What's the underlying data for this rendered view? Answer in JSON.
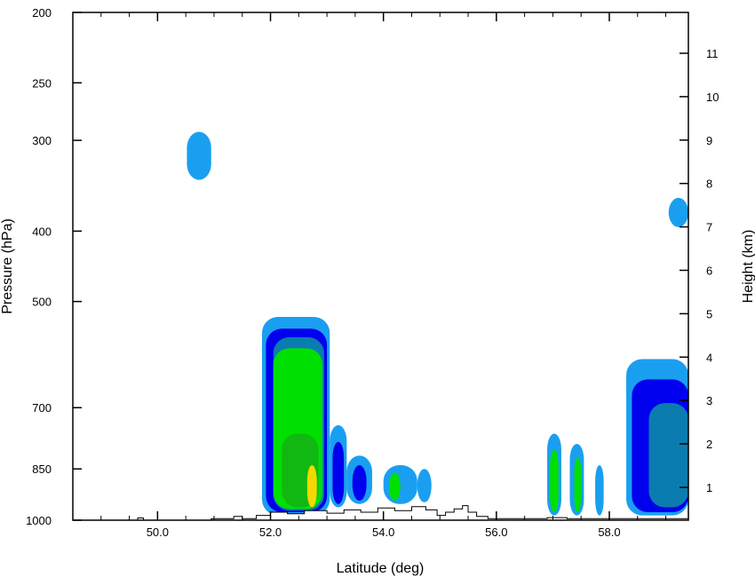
{
  "chart_data": {
    "type": "contour",
    "xlabel": "Latitude (deg)",
    "ylabel_left": "Pressure (hPa)",
    "ylabel_right": "Height (km)",
    "xlim": [
      48.5,
      59.4
    ],
    "x_ticks": [
      {
        "value": 50.0,
        "label": "50.0"
      },
      {
        "value": 52.0,
        "label": "52.0"
      },
      {
        "value": 54.0,
        "label": "54.0"
      },
      {
        "value": 56.0,
        "label": "56.0"
      },
      {
        "value": 58.0,
        "label": "58.0"
      }
    ],
    "x_minor_ticks": [
      48.5,
      49.0,
      49.5,
      50.5,
      51.0,
      51.5,
      52.5,
      53.0,
      53.5,
      54.5,
      55.0,
      55.5,
      56.5,
      57.0,
      57.5,
      58.5,
      59.0
    ],
    "pressure_log_scale": true,
    "pressure_lim": [
      1000,
      200
    ],
    "pressure_ticks": [
      {
        "value": 1000,
        "label": "1000"
      },
      {
        "value": 850,
        "label": "850"
      },
      {
        "value": 700,
        "label": "700"
      },
      {
        "value": 500,
        "label": "500"
      },
      {
        "value": 400,
        "label": "400"
      },
      {
        "value": 300,
        "label": "300"
      },
      {
        "value": 250,
        "label": "250"
      },
      {
        "value": 200,
        "label": "200"
      }
    ],
    "height_ticks": [
      {
        "value": 1,
        "label": "1"
      },
      {
        "value": 2,
        "label": "2"
      },
      {
        "value": 3,
        "label": "3"
      },
      {
        "value": 4,
        "label": "4"
      },
      {
        "value": 5,
        "label": "5"
      },
      {
        "value": 6,
        "label": "6"
      },
      {
        "value": 7,
        "label": "7"
      },
      {
        "value": 8,
        "label": "8"
      },
      {
        "value": 9,
        "label": "9"
      },
      {
        "value": 10,
        "label": "10"
      },
      {
        "value": 11,
        "label": "11"
      }
    ],
    "contour_colors": [
      "#1a9ff0",
      "#0000ee",
      "#0a7cb0",
      "#00e000",
      "#12b812",
      "#f5d800"
    ],
    "cells": [
      {
        "lat": [
          50.52,
          50.95
        ],
        "p_bottom": 340,
        "p_top": 292,
        "level": 1
      },
      {
        "lat": [
          59.05,
          59.4
        ],
        "p_bottom": 395,
        "p_top": 360,
        "level": 1
      },
      {
        "lat": [
          51.85,
          53.05
        ],
        "p_bottom": 985,
        "p_top": 525,
        "level": 1
      },
      {
        "lat": [
          51.92,
          53.0
        ],
        "p_bottom": 975,
        "p_top": 545,
        "level": 2
      },
      {
        "lat": [
          52.05,
          52.95
        ],
        "p_bottom": 970,
        "p_top": 560,
        "level": 3
      },
      {
        "lat": [
          52.05,
          52.92
        ],
        "p_bottom": 965,
        "p_top": 580,
        "level": 4
      },
      {
        "lat": [
          52.2,
          52.85
        ],
        "p_bottom": 960,
        "p_top": 760,
        "level": 5
      },
      {
        "lat": [
          52.65,
          52.82
        ],
        "p_bottom": 960,
        "p_top": 840,
        "level": 6
      },
      {
        "lat": [
          53.05,
          53.35
        ],
        "p_bottom": 960,
        "p_top": 740,
        "level": 1
      },
      {
        "lat": [
          53.1,
          53.3
        ],
        "p_bottom": 950,
        "p_top": 780,
        "level": 2
      },
      {
        "lat": [
          53.35,
          53.8
        ],
        "p_bottom": 950,
        "p_top": 815,
        "level": 1
      },
      {
        "lat": [
          53.45,
          53.7
        ],
        "p_bottom": 940,
        "p_top": 840,
        "level": 2
      },
      {
        "lat": [
          54.0,
          54.6
        ],
        "p_bottom": 950,
        "p_top": 840,
        "level": 1
      },
      {
        "lat": [
          54.1,
          54.3
        ],
        "p_bottom": 940,
        "p_top": 860,
        "level": 4
      },
      {
        "lat": [
          54.6,
          54.85
        ],
        "p_bottom": 945,
        "p_top": 850,
        "level": 1
      },
      {
        "lat": [
          56.9,
          57.15
        ],
        "p_bottom": 985,
        "p_top": 760,
        "level": 1
      },
      {
        "lat": [
          56.95,
          57.1
        ],
        "p_bottom": 975,
        "p_top": 800,
        "level": 4
      },
      {
        "lat": [
          57.3,
          57.55
        ],
        "p_bottom": 985,
        "p_top": 785,
        "level": 1
      },
      {
        "lat": [
          57.38,
          57.5
        ],
        "p_bottom": 975,
        "p_top": 820,
        "level": 4
      },
      {
        "lat": [
          57.75,
          57.9
        ],
        "p_bottom": 985,
        "p_top": 840,
        "level": 1
      },
      {
        "lat": [
          58.3,
          59.4
        ],
        "p_bottom": 985,
        "p_top": 600,
        "level": 1
      },
      {
        "lat": [
          58.4,
          59.4
        ],
        "p_bottom": 975,
        "p_top": 640,
        "level": 2
      },
      {
        "lat": [
          58.7,
          59.4
        ],
        "p_bottom": 960,
        "p_top": 690,
        "level": 3
      }
    ],
    "terrain": [
      {
        "lat": 48.5,
        "p": 1000
      },
      {
        "lat": 49.65,
        "p": 1000
      },
      {
        "lat": 49.65,
        "p": 993
      },
      {
        "lat": 49.75,
        "p": 993
      },
      {
        "lat": 49.75,
        "p": 1000
      },
      {
        "lat": 50.95,
        "p": 1000
      },
      {
        "lat": 50.95,
        "p": 995
      },
      {
        "lat": 51.35,
        "p": 995
      },
      {
        "lat": 51.35,
        "p": 988
      },
      {
        "lat": 51.5,
        "p": 988
      },
      {
        "lat": 51.5,
        "p": 995
      },
      {
        "lat": 51.75,
        "p": 995
      },
      {
        "lat": 51.75,
        "p": 985
      },
      {
        "lat": 52.0,
        "p": 985
      },
      {
        "lat": 52.0,
        "p": 975
      },
      {
        "lat": 52.3,
        "p": 975
      },
      {
        "lat": 52.3,
        "p": 980
      },
      {
        "lat": 52.6,
        "p": 980
      },
      {
        "lat": 52.6,
        "p": 970
      },
      {
        "lat": 53.0,
        "p": 970
      },
      {
        "lat": 53.0,
        "p": 978
      },
      {
        "lat": 53.3,
        "p": 978
      },
      {
        "lat": 53.3,
        "p": 968
      },
      {
        "lat": 53.6,
        "p": 968
      },
      {
        "lat": 53.6,
        "p": 975
      },
      {
        "lat": 53.9,
        "p": 975
      },
      {
        "lat": 53.9,
        "p": 962
      },
      {
        "lat": 54.2,
        "p": 962
      },
      {
        "lat": 54.2,
        "p": 970
      },
      {
        "lat": 54.5,
        "p": 970
      },
      {
        "lat": 54.5,
        "p": 958
      },
      {
        "lat": 54.75,
        "p": 958
      },
      {
        "lat": 54.75,
        "p": 968
      },
      {
        "lat": 54.95,
        "p": 968
      },
      {
        "lat": 54.95,
        "p": 985
      },
      {
        "lat": 55.1,
        "p": 985
      },
      {
        "lat": 55.1,
        "p": 975
      },
      {
        "lat": 55.25,
        "p": 975
      },
      {
        "lat": 55.25,
        "p": 965
      },
      {
        "lat": 55.4,
        "p": 965
      },
      {
        "lat": 55.4,
        "p": 955
      },
      {
        "lat": 55.5,
        "p": 955
      },
      {
        "lat": 55.5,
        "p": 975
      },
      {
        "lat": 55.65,
        "p": 975
      },
      {
        "lat": 55.65,
        "p": 988
      },
      {
        "lat": 55.85,
        "p": 988
      },
      {
        "lat": 55.85,
        "p": 995
      },
      {
        "lat": 56.9,
        "p": 995
      },
      {
        "lat": 56.9,
        "p": 992
      },
      {
        "lat": 57.25,
        "p": 992
      },
      {
        "lat": 57.25,
        "p": 995
      },
      {
        "lat": 59.4,
        "p": 995
      }
    ]
  }
}
